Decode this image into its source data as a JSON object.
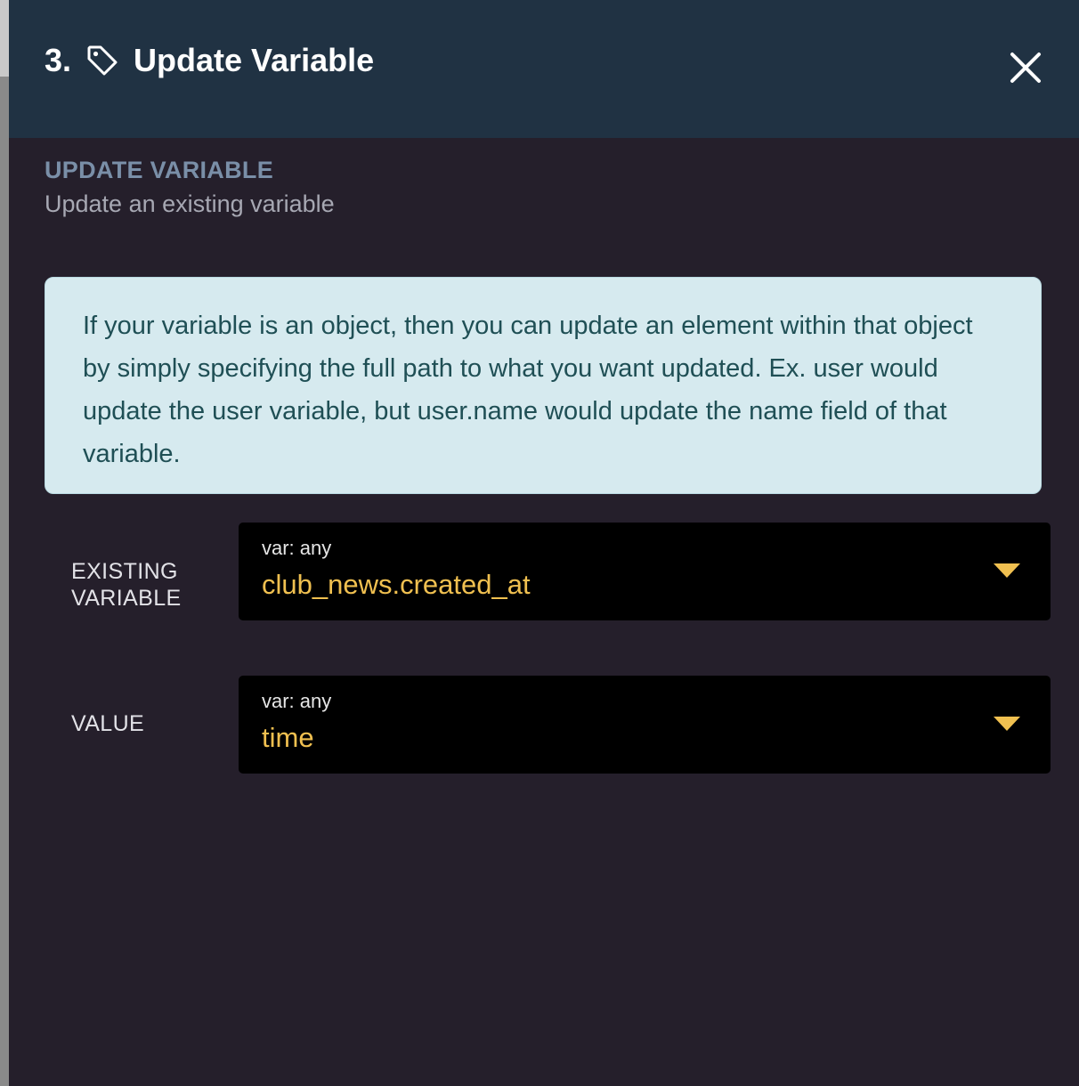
{
  "header": {
    "step_number": "3.",
    "title": "Update Variable",
    "background_color": "#203243"
  },
  "section": {
    "label": "UPDATE VARIABLE",
    "description": "Update an existing variable"
  },
  "info_box": {
    "text": "If your variable is an object, then you can update an element within that object by simply specifying the full path to what you want updated. Ex. user would update the user variable, but user.name would update the name field of that variable."
  },
  "fields": [
    {
      "label": "EXISTING VARIABLE",
      "type_label": "var: any",
      "value": "club_news.created_at"
    },
    {
      "label": "VALUE",
      "type_label": "var: any",
      "value": "time"
    }
  ],
  "colors": {
    "panel_background": "#251f2b",
    "value_text": "#f0c050",
    "info_background": "#d6eaef",
    "info_text": "#1f4f55"
  },
  "icons": {
    "title_icon": "tag-icon",
    "close": "close-icon",
    "dropdown": "chevron-down-icon"
  }
}
